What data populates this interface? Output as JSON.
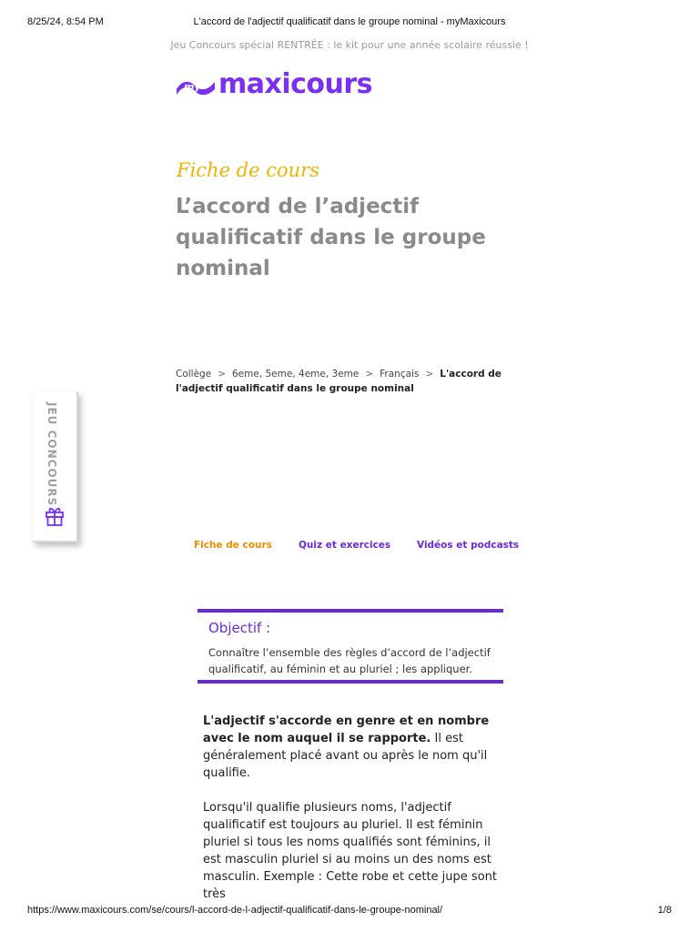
{
  "print_header": {
    "date": "8/25/24, 8:54 PM",
    "title": "L'accord de l'adjectif qualificatif dans le groupe nominal - myMaxicours"
  },
  "promo_banner": "Jeu Concours spécial RENTRÉE : le kit pour une année scolaire réussie !",
  "logo": {
    "prefix": "my",
    "brand": "maxicours",
    "color": "#7b2ff2"
  },
  "page": {
    "label": "Fiche de cours",
    "title": "L’accord de l’adjectif qualificatif dans le groupe nominal"
  },
  "breadcrumb": {
    "items": [
      "Collège",
      "6eme, 5eme, 4eme, 3eme",
      "Français"
    ],
    "separator": ">",
    "current": "L'accord de l'adjectif qualificatif dans le groupe nominal"
  },
  "side_tab": {
    "label": "JEU CONCOURS",
    "icon": "gift-icon"
  },
  "tabs": [
    {
      "label": "Fiche de cours",
      "color": "#f08c00"
    },
    {
      "label": "Quiz et exercices",
      "color": "#6a2ad8"
    },
    {
      "label": "Vidéos et podcasts",
      "color": "#6a2ad8"
    }
  ],
  "objectif": {
    "title": "Objectif :",
    "text": "Connaître l’ensemble des règles d’accord de l’adjectif qualificatif, au féminin et au pluriel ; les appliquer."
  },
  "content": {
    "p1_bold": "L'adjectif s'accorde en genre et en nombre avec le nom auquel il se rapporte.",
    "p1_rest": " Il est généralement placé avant ou après le nom qu'il qualifie.",
    "p2": "Lorsqu'il qualifie plusieurs noms, l'adjectif qualificatif est toujours au pluriel. Il est féminin pluriel si tous les noms qualifiés sont féminins, il est masculin pluriel si au moins un des noms est masculin. Exemple : Cette robe et cette jupe sont très"
  },
  "print_footer": {
    "url": "https://www.maxicours.com/se/cours/l-accord-de-l-adjectif-qualificatif-dans-le-groupe-nominal/",
    "page": "1/8"
  }
}
